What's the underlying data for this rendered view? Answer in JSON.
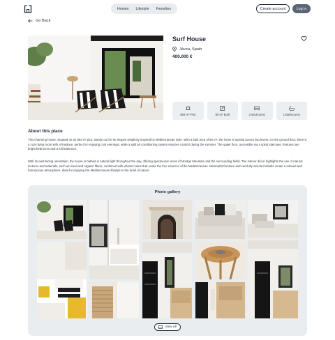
{
  "header": {
    "logo_icon": "house-logo-icon",
    "nav": [
      "Homes",
      "Lifestyle",
      "Favorites"
    ],
    "create_account": "Create account",
    "login": "Log in"
  },
  "back_label": "Go Back",
  "property": {
    "title": "Surf House",
    "location": "Jávea, Spain",
    "price": "400.000 €",
    "features": [
      {
        "icon": "plot-icon",
        "label": "883 m² Plot"
      },
      {
        "icon": "built-area-icon",
        "label": "80 m² Built"
      },
      {
        "icon": "bed-icon",
        "label": "2 Bedrooms"
      },
      {
        "icon": "bath-icon",
        "label": "1 Bathrooms"
      }
    ]
  },
  "about": {
    "heading": "About this place",
    "p1": "This charming house, situated on an 883 m² plot, stands out for its elegant simplicity inspired by Mediterranean style. With a built area of 80 m², the home is spread across two levels. On the ground floor, there is a cozy living room with a fireplace, perfect for enjoying cool evenings, while a split air conditioning system ensures comfort during the summer. The upper floor, accessible via a spiral staircase, features two bright bedrooms and a full bathroom.",
    "p2": "With its east-facing orientation, the house is bathed in natural light throughout the day, offering spectacular views of Montgó Mountain and the surrounding fields. The interior décor highlights the use of natural textures and materials, such as wood and organic fibers, combined with vibrant colors that evoke the true essence of the Mediterranean. Minimalist furniture and carefully selected details create a relaxed and harmonious atmosphere, ideal for enjoying the Mediterranean lifestyle in the heart of nature."
  },
  "gallery": {
    "heading": "Photo gallery",
    "view_all": "View all"
  },
  "colors": {
    "accent": "#5b6573",
    "panel": "#e9edef",
    "chip": "#eceff1"
  }
}
